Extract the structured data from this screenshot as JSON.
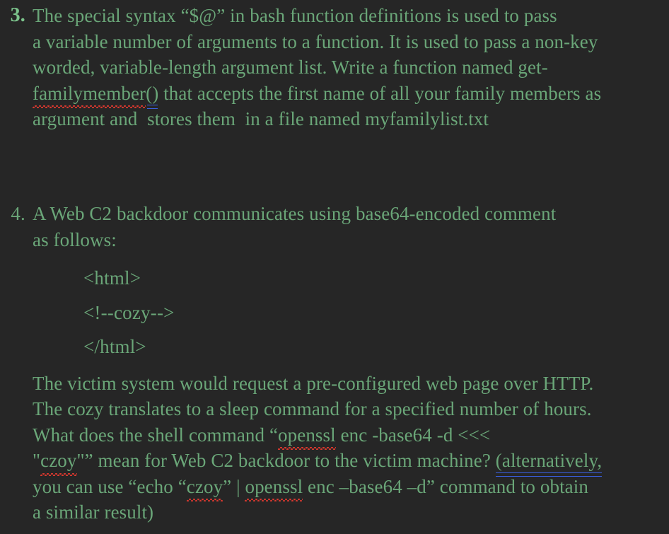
{
  "document": {
    "background_color": "#262626",
    "text_color": "#6aa678",
    "marker_accent_color": "#7cc48c",
    "spellcheck_color": "#d8382e",
    "grammar_color": "#3a5fe0"
  },
  "items": [
    {
      "marker": "3.",
      "lines": [
        "The special syntax “$@” in bash function definitions is used to pass",
        "a variable number of arguments to a function. It is used to pass a non-key",
        "worded, variable-length argument list. Write a function named get-",
        "argument and  stores them  in a file named myfamilylist.txt"
      ],
      "line4": {
        "spell_word": "familymember",
        "gram_word": "()",
        "rest": " that accepts the first name of all your family members as"
      }
    },
    {
      "marker": "4.",
      "lines": [
        "A Web C2 backdoor communicates using base64-encoded comment",
        "as follows:"
      ],
      "code_lines": [
        "<html>",
        "<!--cozy-->",
        "</html>"
      ],
      "paragraph": {
        "line1": "The victim system would request a pre-configured web page over HTTP.",
        "line2": "The cozy translates to a sleep command for a specified number of hours.",
        "line3_pre": "What does the shell command “",
        "line3_spell": "openssl",
        "line3_post": " enc -base64 -d <<<",
        "line4_pre": "\"",
        "line4_spell": "czoy",
        "line4_mid": "\"” mean for Web C2 backdoor to the victim machine? ",
        "line4_gram": "(alternatively,",
        "line5_pre": "you can use “echo “",
        "line5_spell1": "czoy",
        "line5_mid": "” | ",
        "line5_spell2": "openssl",
        "line5_post": " enc –base64 –d” command to obtain",
        "line6": "a similar result)"
      }
    }
  ]
}
